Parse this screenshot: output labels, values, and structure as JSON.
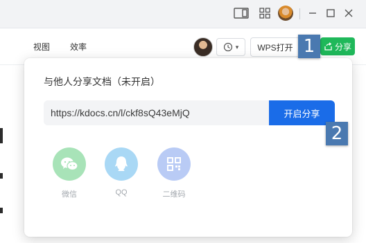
{
  "toolbar": {
    "menu": [
      "视图",
      "效率"
    ],
    "wps_open_label": "WPS打开",
    "share_label": "分享"
  },
  "share_popup": {
    "title": "与他人分享文档（未开启）",
    "link": "https://kdocs.cn/l/ckf8sQ43eMjQ",
    "start_share_label": "开启分享",
    "targets": [
      {
        "label": "微信",
        "icon": "wechat-icon",
        "color": "#a8e3b8"
      },
      {
        "label": "QQ",
        "icon": "qq-icon",
        "color": "#a9d8f5"
      },
      {
        "label": "二维码",
        "icon": "qr-code-icon",
        "color": "#b9cbf5"
      }
    ]
  },
  "annotations": [
    "1",
    "2"
  ],
  "colors": {
    "share_green": "#1fb85a",
    "start_share_blue": "#1a6ce8",
    "badge_blue": "#4a79b0"
  }
}
